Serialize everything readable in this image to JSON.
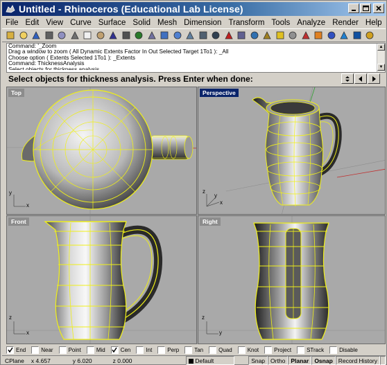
{
  "window": {
    "title": "Untitled - Rhinoceros (Educational Lab License)"
  },
  "menu": [
    "File",
    "Edit",
    "View",
    "Curve",
    "Surface",
    "Solid",
    "Mesh",
    "Dimension",
    "Transform",
    "Tools",
    "Analyze",
    "Render",
    "Help"
  ],
  "toolbar_icons": [
    "new-icon",
    "open-icon",
    "save-icon",
    "print-icon",
    "export-icon",
    "cut-icon",
    "copy-icon",
    "paste-icon",
    "undo-icon",
    "pan-icon",
    "rotate-view-icon",
    "zoom-window-icon",
    "zoom-dynamic-icon",
    "zoom-extents-icon",
    "zoom-selected-icon",
    "four-views-icon",
    "grid-icon",
    "layer-icon",
    "select-icon",
    "object-properties-icon",
    "snap-icon",
    "lightbulb-icon",
    "lock-icon",
    "shaded-icon",
    "render-icon",
    "sphere-icon",
    "material-icon",
    "help-icon",
    "extra-icon"
  ],
  "command_history": [
    "Command: '_Zoom",
    "Drag a window to zoom ( All  Dynamic  Extents  Factor  In  Out  Selected  Target  1To1 ): _All",
    "Choose option ( Extents  Selected  1To1 ): _Extents",
    "Command: ThicknessAnalysis",
    "Select objects for thickness analysis"
  ],
  "command_prompt": "Select objects for thickness analysis. Press Enter when done:",
  "viewports": {
    "top": "Top",
    "perspective": "Perspective",
    "front": "Front",
    "right": "Right"
  },
  "axis_labels": {
    "x": "x",
    "y": "y",
    "z": "z"
  },
  "osnaps": [
    {
      "label": "End",
      "checked": true
    },
    {
      "label": "Near",
      "checked": false
    },
    {
      "label": "Point",
      "checked": false
    },
    {
      "label": "Mid",
      "checked": false
    },
    {
      "label": "Cen",
      "checked": true
    },
    {
      "label": "Int",
      "checked": false
    },
    {
      "label": "Perp",
      "checked": false
    },
    {
      "label": "Tan",
      "checked": false
    },
    {
      "label": "Quad",
      "checked": false
    },
    {
      "label": "Knot",
      "checked": false
    },
    {
      "label": "Project",
      "checked": false
    },
    {
      "label": "STrack",
      "checked": false
    },
    {
      "label": "Disable",
      "checked": false
    }
  ],
  "status": {
    "cplane": "CPlane",
    "x": "x 4.657",
    "y": "y 6.020",
    "z": "z 0.000",
    "layer": "Default",
    "snap": "Snap",
    "ortho": "Ortho",
    "planar": "Planar",
    "osnap": "Osnap",
    "record_history": "Record History"
  },
  "colors": {
    "title_active": "#0a246a",
    "wire": "#f0f018",
    "x_axis": "#c03030",
    "y_axis": "#30a030"
  }
}
